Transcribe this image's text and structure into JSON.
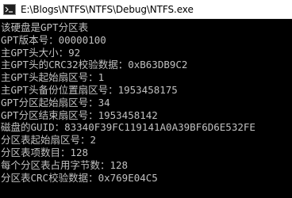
{
  "window": {
    "title": "E:\\Blogs\\NTFS\\NTFS\\Debug\\NTFS.exe",
    "icon": "console-app-icon"
  },
  "console": {
    "lines": [
      "该硬盘是GPT分区表",
      "GPT版本号：00000100",
      "主GPT头大小：92",
      "主GPT头的CRC32校验数据：0xB63DB9C2",
      "主GPT头起始扇区号：1",
      "主GPT头备份位置扇区号：1953458175",
      "GPT分区起始扇区号：34",
      "GPT分区结束扇区号：1953458142",
      "磁盘的GUID：83340F39FC119141A0A39BF6D6E532FE",
      "分区表起始扇区号：2",
      "分区表项数目：128",
      "每个分区表占用字节数：128",
      "分区表CRC校验数据：0x769E04C5"
    ]
  },
  "colors": {
    "console_bg": "#000000",
    "console_text": "#c0c0c0",
    "titlebar_bg": "#ffffff"
  }
}
